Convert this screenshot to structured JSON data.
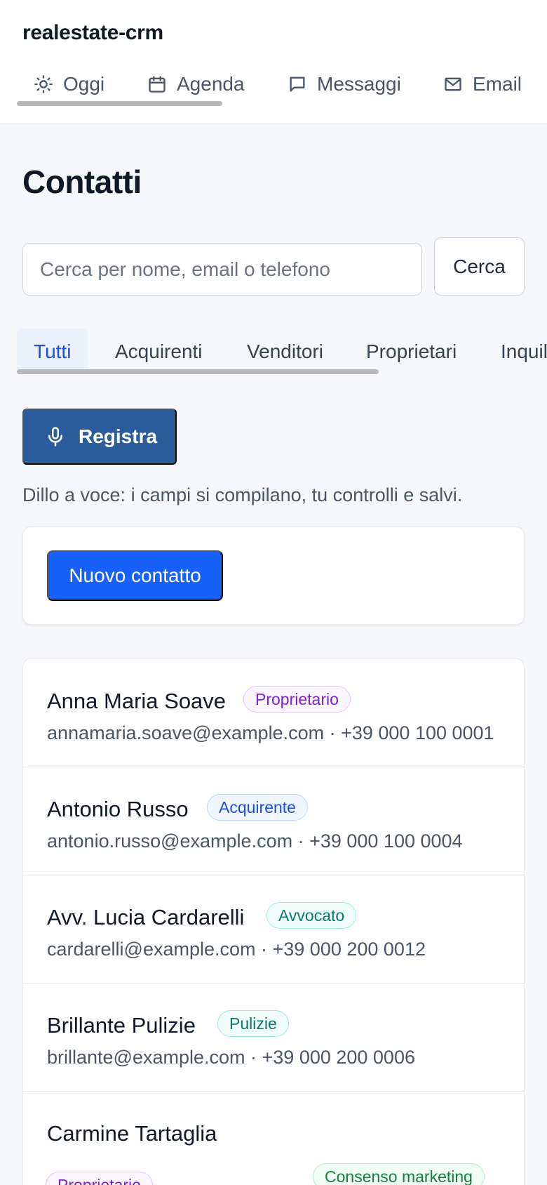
{
  "app": {
    "title": "realestate-crm"
  },
  "nav": {
    "tabs": [
      {
        "label": "Oggi",
        "icon": "sun-icon"
      },
      {
        "label": "Agenda",
        "icon": "calendar-icon"
      },
      {
        "label": "Messaggi",
        "icon": "message-icon"
      },
      {
        "label": "Email",
        "icon": "mail-icon"
      }
    ]
  },
  "page": {
    "title": "Contatti"
  },
  "search": {
    "placeholder": "Cerca per nome, email o telefono",
    "value": "",
    "button_label": "Cerca"
  },
  "filters": {
    "active": "Tutti",
    "tabs": [
      "Tutti",
      "Acquirenti",
      "Venditori",
      "Proprietari",
      "Inquilini"
    ]
  },
  "voice": {
    "button_label": "Registra",
    "icon": "microphone-icon",
    "hint": "Dillo a voce: i campi si compilano, tu controlli e salvi."
  },
  "new_contact": {
    "button_label": "Nuovo contatto"
  },
  "contacts": [
    {
      "name": "Anna Maria Soave",
      "badge": "Proprietario",
      "badge_color": "purple",
      "meta": "annamaria.soave@example.com · +39 000 100 0001"
    },
    {
      "name": "Antonio Russo",
      "badge": "Acquirente",
      "badge_color": "blue",
      "meta": "antonio.russo@example.com · +39 000 100 0004"
    },
    {
      "name": "Avv. Lucia Cardarelli",
      "badge": "Avvocato",
      "badge_color": "teal",
      "meta": "cardarelli@example.com · +39 000 200 0012"
    },
    {
      "name": "Brillante Pulizie",
      "badge": "Pulizie",
      "badge_color": "teal",
      "meta": "brillante@example.com · +39 000 200 0006"
    },
    {
      "name": "Carmine Tartaglia",
      "badge": "Proprietario",
      "badge_color": "purple",
      "extra_badge": "Consenso marketing",
      "extra_badge_color": "green"
    }
  ],
  "colors": {
    "primary": "#1760fa",
    "voice_button": "#2b5d9c",
    "active_tab": "#1d4ed8",
    "background": "#f5f7fa"
  }
}
